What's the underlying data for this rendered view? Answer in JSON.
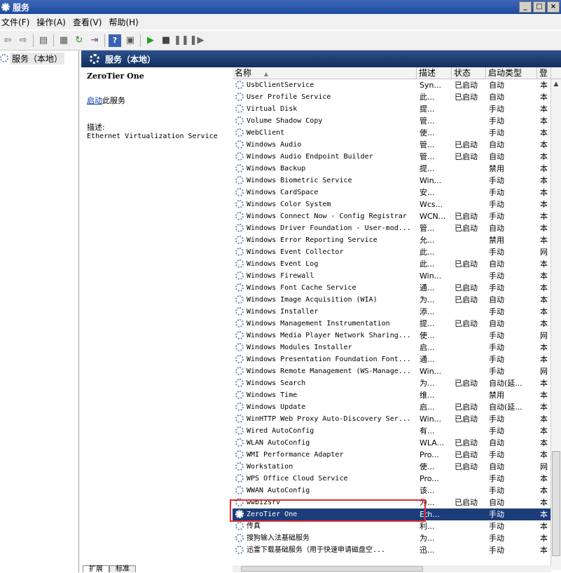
{
  "window": {
    "title": "服务"
  },
  "menu": [
    "文件(F)",
    "操作(A)",
    "查看(V)",
    "帮助(H)"
  ],
  "tree": {
    "root": "服务（本地）"
  },
  "pane": {
    "title": "服务（本地）",
    "selected_name": "ZeroTier One",
    "start_link": "启动",
    "start_suffix": "此服务",
    "desc_label": "描述:",
    "desc_text": "Ethernet Virtualization Service"
  },
  "columns": {
    "name": "名称",
    "desc": "描述",
    "status": "状态",
    "start": "启动类型",
    "logon": "登"
  },
  "rows": [
    {
      "name": "UsbClientService",
      "desc": "Syn...",
      "status": "已启动",
      "start": "自动",
      "logon": "本"
    },
    {
      "name": "User Profile Service",
      "desc": "此...",
      "status": "已启动",
      "start": "自动",
      "logon": "本"
    },
    {
      "name": "Virtual Disk",
      "desc": "提...",
      "status": "",
      "start": "手动",
      "logon": "本"
    },
    {
      "name": "Volume Shadow Copy",
      "desc": "管...",
      "status": "",
      "start": "手动",
      "logon": "本"
    },
    {
      "name": "WebClient",
      "desc": "使...",
      "status": "",
      "start": "手动",
      "logon": "本"
    },
    {
      "name": "Windows Audio",
      "desc": "管...",
      "status": "已启动",
      "start": "自动",
      "logon": "本"
    },
    {
      "name": "Windows Audio Endpoint Builder",
      "desc": "管...",
      "status": "已启动",
      "start": "自动",
      "logon": "本"
    },
    {
      "name": "Windows Backup",
      "desc": "提...",
      "status": "",
      "start": "禁用",
      "logon": "本"
    },
    {
      "name": "Windows Biometric Service",
      "desc": "Win...",
      "status": "",
      "start": "手动",
      "logon": "本"
    },
    {
      "name": "Windows CardSpace",
      "desc": "安...",
      "status": "",
      "start": "手动",
      "logon": "本"
    },
    {
      "name": "Windows Color System",
      "desc": "Wcs...",
      "status": "",
      "start": "手动",
      "logon": "本"
    },
    {
      "name": "Windows Connect Now - Config Registrar",
      "desc": "WCN...",
      "status": "已启动",
      "start": "手动",
      "logon": "本"
    },
    {
      "name": "Windows Driver Foundation - User-mod...",
      "desc": "管...",
      "status": "已启动",
      "start": "自动",
      "logon": "本"
    },
    {
      "name": "Windows Error Reporting Service",
      "desc": "允...",
      "status": "",
      "start": "禁用",
      "logon": "本"
    },
    {
      "name": "Windows Event Collector",
      "desc": "此...",
      "status": "",
      "start": "手动",
      "logon": "网"
    },
    {
      "name": "Windows Event Log",
      "desc": "此...",
      "status": "已启动",
      "start": "自动",
      "logon": "本"
    },
    {
      "name": "Windows Firewall",
      "desc": "Win...",
      "status": "",
      "start": "手动",
      "logon": "本"
    },
    {
      "name": "Windows Font Cache Service",
      "desc": "通...",
      "status": "已启动",
      "start": "手动",
      "logon": "本"
    },
    {
      "name": "Windows Image Acquisition (WIA)",
      "desc": "为...",
      "status": "已启动",
      "start": "自动",
      "logon": "本"
    },
    {
      "name": "Windows Installer",
      "desc": "添...",
      "status": "",
      "start": "手动",
      "logon": "本"
    },
    {
      "name": "Windows Management Instrumentation",
      "desc": "提...",
      "status": "已启动",
      "start": "自动",
      "logon": "本"
    },
    {
      "name": "Windows Media Player Network Sharing...",
      "desc": "使...",
      "status": "",
      "start": "手动",
      "logon": "网"
    },
    {
      "name": "Windows Modules Installer",
      "desc": "启...",
      "status": "",
      "start": "手动",
      "logon": "本"
    },
    {
      "name": "Windows Presentation Foundation Font...",
      "desc": "通...",
      "status": "",
      "start": "手动",
      "logon": "本"
    },
    {
      "name": "Windows Remote Management (WS-Manage...",
      "desc": "Win...",
      "status": "",
      "start": "手动",
      "logon": "网"
    },
    {
      "name": "Windows Search",
      "desc": "为...",
      "status": "已启动",
      "start": "自动(延...",
      "logon": "本"
    },
    {
      "name": "Windows Time",
      "desc": "维...",
      "status": "",
      "start": "禁用",
      "logon": "本"
    },
    {
      "name": "Windows Update",
      "desc": "启...",
      "status": "已启动",
      "start": "自动(延...",
      "logon": "本"
    },
    {
      "name": "WinHTTP Web Proxy Auto-Discovery Ser...",
      "desc": "Win...",
      "status": "已启动",
      "start": "手动",
      "logon": "本"
    },
    {
      "name": "Wired AutoConfig",
      "desc": "有...",
      "status": "",
      "start": "手动",
      "logon": "本"
    },
    {
      "name": "WLAN AutoConfig",
      "desc": "WLA...",
      "status": "已启动",
      "start": "自动",
      "logon": "本"
    },
    {
      "name": "WMI Performance Adapter",
      "desc": "Pro...",
      "status": "已启动",
      "start": "手动",
      "logon": "本"
    },
    {
      "name": "Workstation",
      "desc": "使...",
      "status": "已启动",
      "start": "自动",
      "logon": "网"
    },
    {
      "name": "WPS Office Cloud Service",
      "desc": "Pro...",
      "status": "",
      "start": "手动",
      "logon": "本"
    },
    {
      "name": "WWAN AutoConfig",
      "desc": "该...",
      "status": "",
      "start": "手动",
      "logon": "本"
    },
    {
      "name": "wwbizsrv",
      "desc": "为...",
      "status": "已启动",
      "start": "自动",
      "logon": "本"
    },
    {
      "name": "ZeroTier One",
      "desc": "Eth...",
      "status": "",
      "start": "手动",
      "logon": "本"
    },
    {
      "name": "传真",
      "desc": "利...",
      "status": "",
      "start": "手动",
      "logon": "本"
    },
    {
      "name": "搜狗输入法基础服务",
      "desc": "为...",
      "status": "",
      "start": "手动",
      "logon": "本"
    },
    {
      "name": "迅雷下载基础服务（用于快速申请磁盘空...",
      "desc": "迅...",
      "status": "",
      "start": "手动",
      "logon": "本"
    }
  ],
  "selected_index": 36,
  "tabs": [
    "扩展",
    "标准"
  ]
}
